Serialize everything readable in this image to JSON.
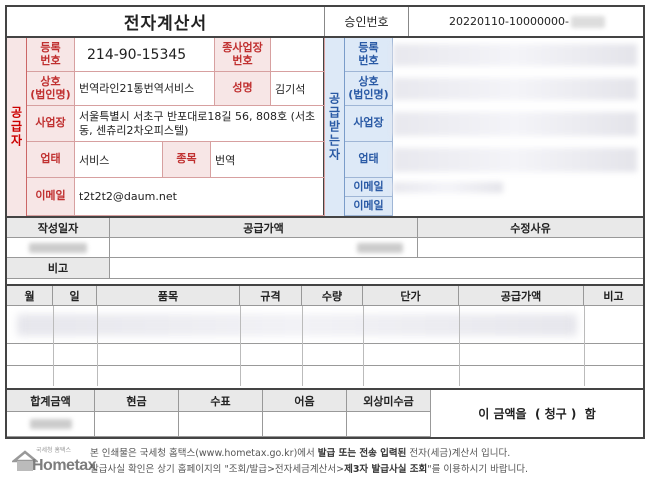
{
  "header": {
    "title": "전자계산서",
    "approval_label": "승인번호",
    "approval_number": "20220110-10000000-"
  },
  "supplier": {
    "side_label": "공급자",
    "reg_no_label": "등록\n번호",
    "reg_no": "214-90-15345",
    "branch_label": "종사업장\n번호",
    "branch_value": "",
    "name_label": "상호\n(법인명)",
    "name": "번역라인21통번역서비스",
    "rep_label": "성명",
    "rep": "김기석",
    "address_label": "사업장",
    "address": "서울특별시 서초구 반포대로18길 56, 808호 (서초동, 센츄리2차오피스텔)",
    "biztype_label": "업태",
    "biztype": "서비스",
    "item_label": "종목",
    "item": "번역",
    "email_label": "이메일",
    "email": "t2t2t2@daum.net"
  },
  "recipient": {
    "side_label": "공급받는자",
    "reg_no_label": "등록\n번호",
    "name_label": "상호\n(법인명)",
    "address_label": "사업장",
    "biztype_label": "업태",
    "email1_label": "이메일",
    "email2_label": "이메일"
  },
  "summary": {
    "date_label": "작성일자",
    "amount_label": "공급가액",
    "reason_label": "수정사유",
    "remark_label": "비고"
  },
  "items_header": {
    "month": "월",
    "day": "일",
    "item": "품목",
    "spec": "규격",
    "qty": "수량",
    "unit_price": "단가",
    "amount": "공급가액",
    "remark": "비고"
  },
  "totals": {
    "total_label": "합계금액",
    "cash_label": "현금",
    "check_label": "수표",
    "note_label": "어음",
    "credit_label": "외상미수금",
    "statement": "이 금액을  ( 청구 )  함"
  },
  "footer": {
    "logo_text": "Hometax",
    "logo_sub": "국세청 홈택스",
    "line1_pre": "본 인쇄물은 국세청 홈택스(www.hometax.go.kr)에서 ",
    "line1_bold": "발급 또는 전송 입력된",
    "line1_post": " 전자(세금)계산서 입니다.",
    "line2_pre": "발급사실 확인은 상기 홈페이지의 \"조회/발급>전자세금계산서>",
    "line2_bold": "제3자 발급사실 조회",
    "line2_post": "\"를 이용하시기 바랍니다."
  },
  "colors": {
    "supplier_accent": "#c03030",
    "supplier_bg": "#f7e6e6",
    "recipient_accent": "#2a5aa5",
    "recipient_bg": "#dde9f7"
  }
}
